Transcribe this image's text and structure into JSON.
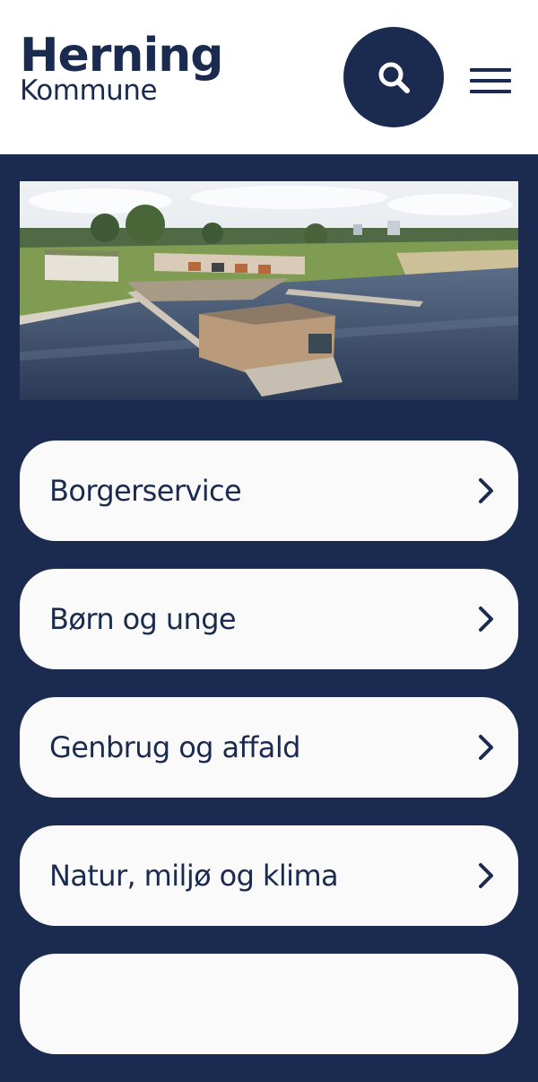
{
  "header": {
    "logo_main": "Herning",
    "logo_sub": "Kommune",
    "search_icon": "search-icon",
    "menu_icon": "hamburger-menu-icon"
  },
  "hero": {
    "image": "aerial-lake-bath-house-photo"
  },
  "nav": {
    "items": [
      {
        "label": "Borgerservice"
      },
      {
        "label": "Børn og unge"
      },
      {
        "label": "Genbrug og affald"
      },
      {
        "label": "Natur, miljø og klima"
      }
    ]
  },
  "colors": {
    "brand_navy": "#1b2b4f",
    "card_background": "#fafafa",
    "header_background": "#ffffff"
  }
}
